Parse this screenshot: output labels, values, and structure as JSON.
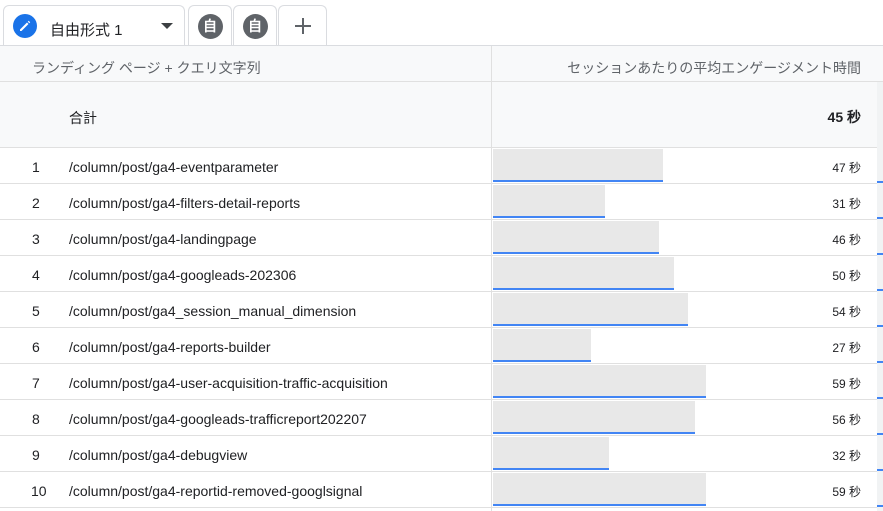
{
  "tabs": {
    "active_label": "自由形式 1",
    "icon_glyph": "自",
    "add_glyph": "+"
  },
  "table": {
    "dimension_header": "ランディング ページ + クエリ文字列",
    "metric_header": "セッションあたりの平均エンゲージメント時間",
    "total_label": "合計",
    "total_value": "45 秒",
    "max_value_seconds": 72,
    "rows": [
      {
        "num": "1",
        "path": "/column/post/ga4-eventparameter",
        "value": "47 秒",
        "seconds": 47
      },
      {
        "num": "2",
        "path": "/column/post/ga4-filters-detail-reports",
        "value": "31 秒",
        "seconds": 31
      },
      {
        "num": "3",
        "path": "/column/post/ga4-landingpage",
        "value": "46 秒",
        "seconds": 46
      },
      {
        "num": "4",
        "path": "/column/post/ga4-googleads-202306",
        "value": "50 秒",
        "seconds": 50
      },
      {
        "num": "5",
        "path": "/column/post/ga4_session_manual_dimension",
        "value": "54 秒",
        "seconds": 54
      },
      {
        "num": "6",
        "path": "/column/post/ga4-reports-builder",
        "value": "27 秒",
        "seconds": 27
      },
      {
        "num": "7",
        "path": "/column/post/ga4-user-acquisition-traffic-acquisition",
        "value": "59 秒",
        "seconds": 59
      },
      {
        "num": "8",
        "path": "/column/post/ga4-googleads-trafficreport202207",
        "value": "56 秒",
        "seconds": 56
      },
      {
        "num": "9",
        "path": "/column/post/ga4-debugview",
        "value": "32 秒",
        "seconds": 32
      },
      {
        "num": "10",
        "path": "/column/post/ga4-reportid-removed-googlsignal",
        "value": "59 秒",
        "seconds": 59
      }
    ]
  },
  "colors": {
    "accent_blue": "#1a73e8",
    "bar_fill": "#e8e8e8",
    "bar_line": "#4285f4"
  }
}
